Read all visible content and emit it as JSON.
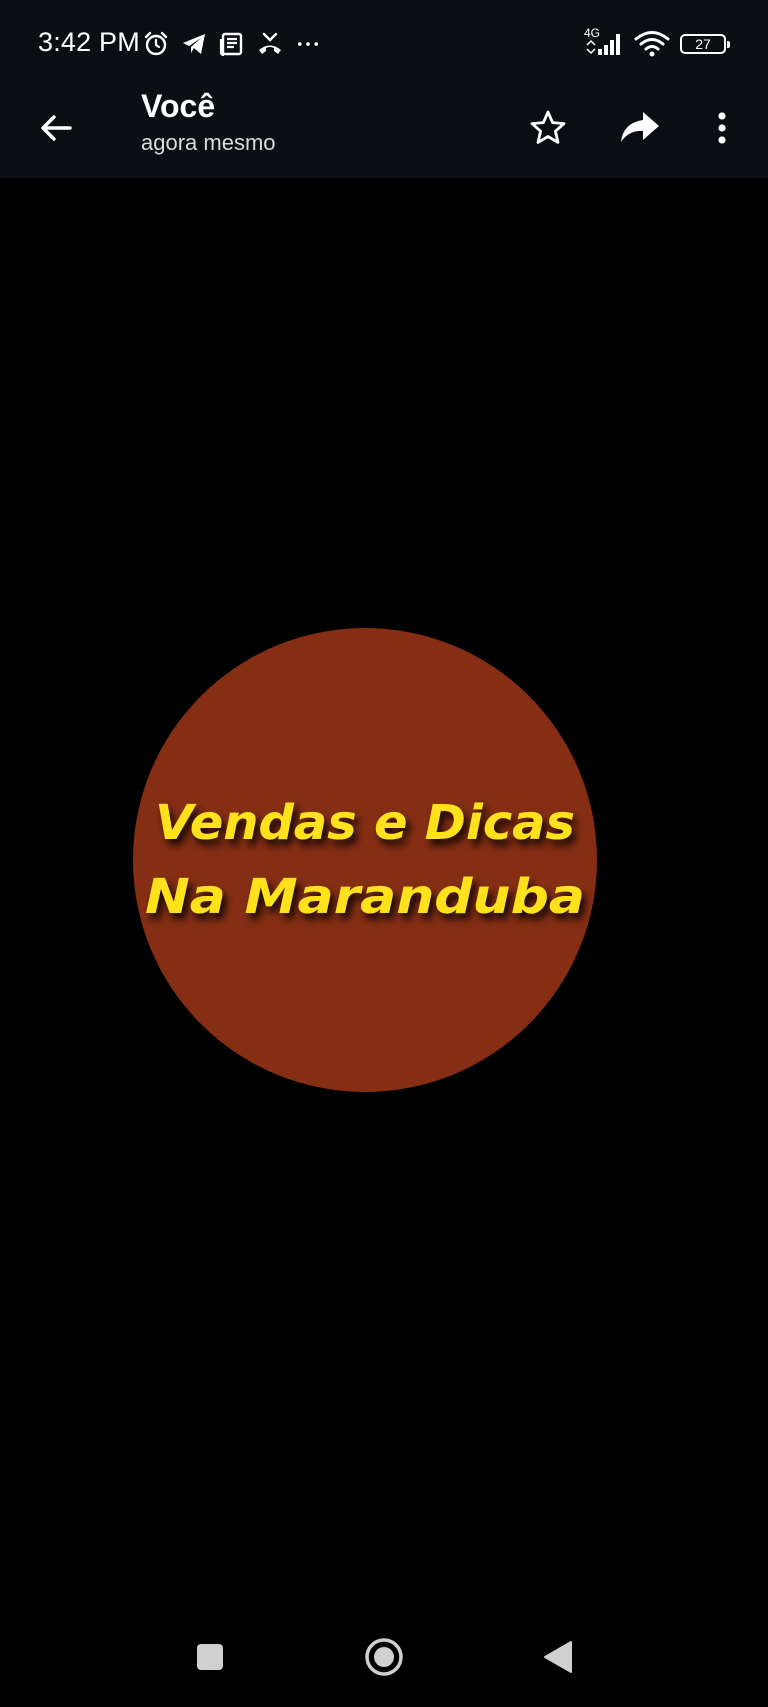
{
  "status_bar": {
    "time": "3:42 PM",
    "network_type": "4G",
    "battery_level": "27",
    "left_icons": [
      "alarm-icon",
      "telegram-icon",
      "news-icon",
      "missed-call-icon",
      "more-notifications-icon"
    ],
    "right_icons": [
      "signal-icon",
      "wifi-icon",
      "battery-icon"
    ]
  },
  "app_bar": {
    "title": "Você",
    "subtitle": "agora mesmo",
    "actions": [
      "star-icon",
      "share-icon",
      "more-vert-icon"
    ]
  },
  "image": {
    "logo_text": "Vendas e Dicas Na Maranduba",
    "circle_color": "#852e13",
    "text_color": "#ffe11f"
  },
  "nav_bar": {
    "buttons": [
      "recents-button",
      "home-button",
      "back-nav-button"
    ]
  },
  "colors": {
    "topbar_background": "#0b0e12",
    "viewer_background": "#000000",
    "nav_icon_color": "#d0d0d0"
  }
}
